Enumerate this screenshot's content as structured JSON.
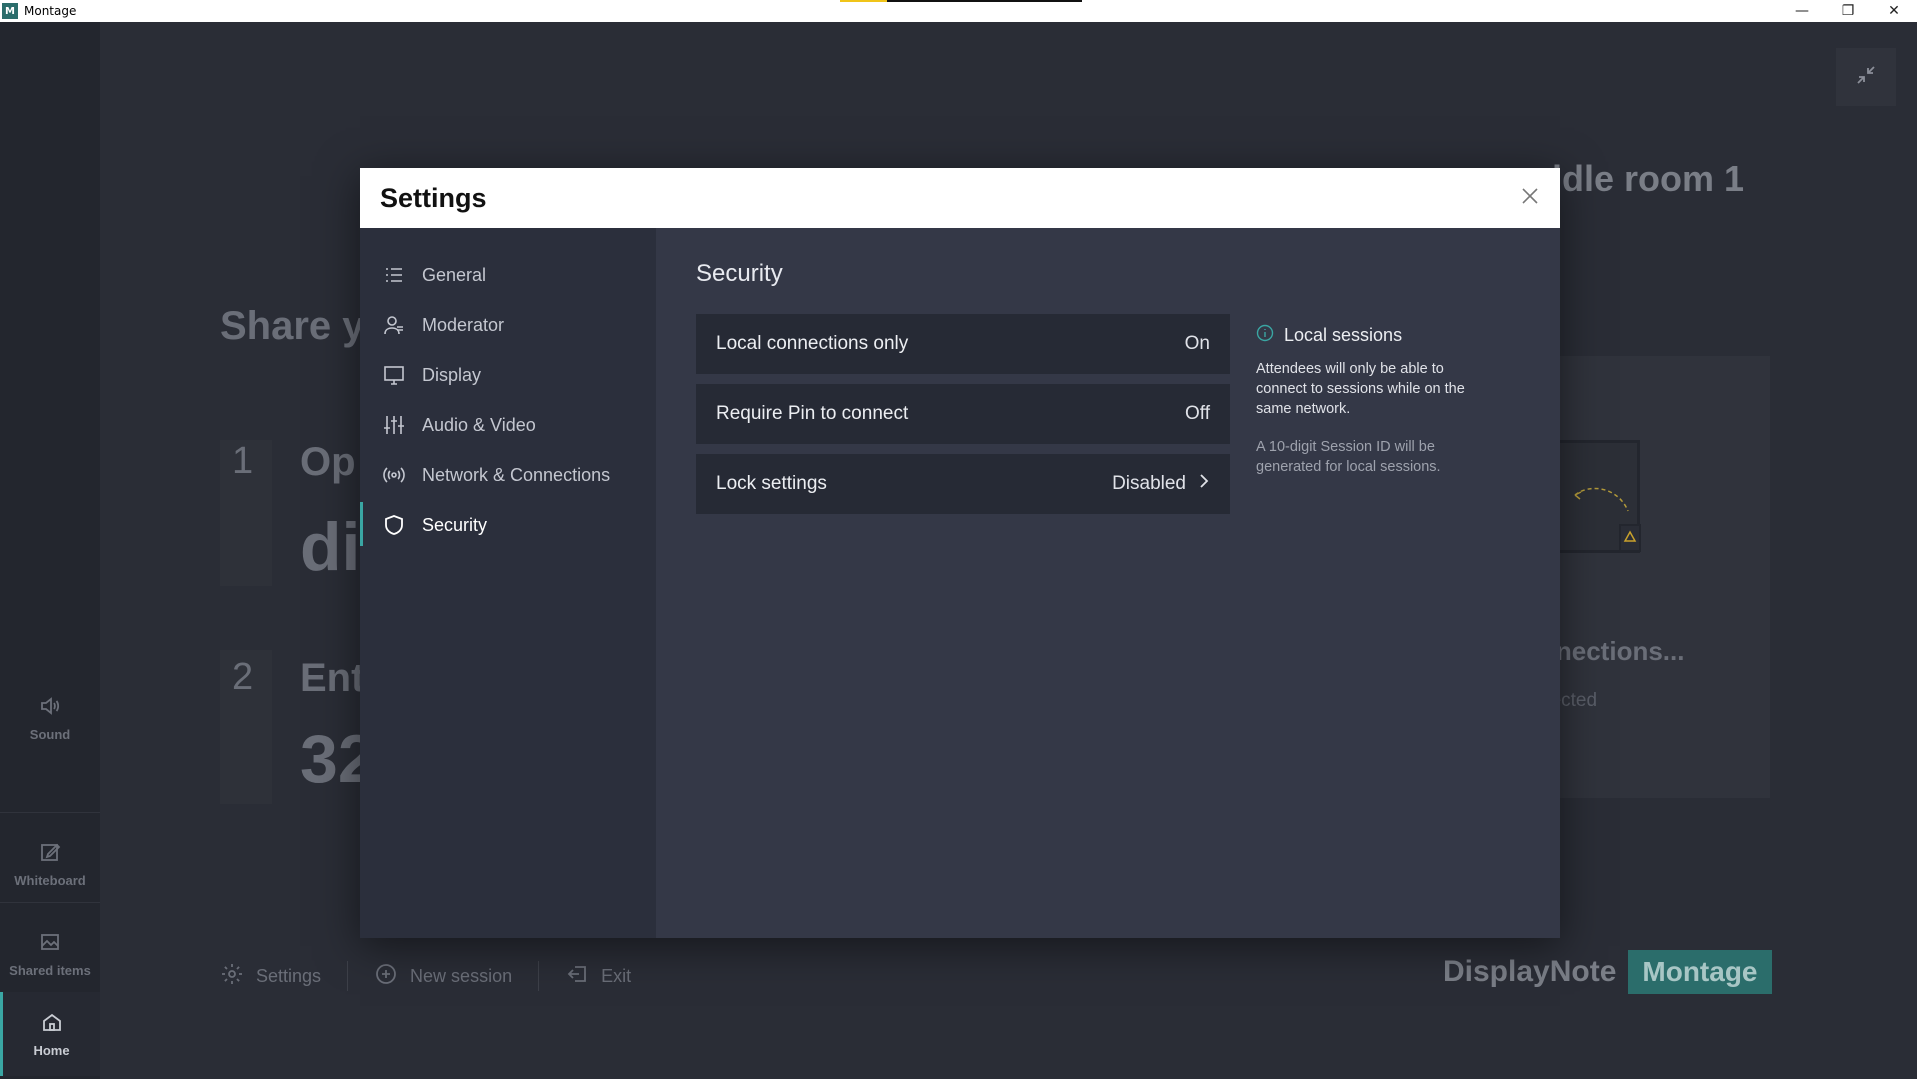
{
  "window": {
    "app_icon_letter": "M",
    "title": "Montage",
    "minimize": "—",
    "restore": "❐",
    "close": "✕"
  },
  "sidebar": {
    "items": [
      {
        "label": "Sound",
        "icon": "speaker-icon"
      },
      {
        "label": "Whiteboard",
        "icon": "edit-icon"
      },
      {
        "label": "Shared items",
        "icon": "image-icon"
      },
      {
        "label": "Home",
        "icon": "home-icon"
      }
    ]
  },
  "background": {
    "room_title": "ddle room 1",
    "share_title": "Share y",
    "step1": {
      "num": "1",
      "label": "Op",
      "big": "di"
    },
    "step2": {
      "num": "2",
      "label": "Ent",
      "big": "32"
    },
    "connections_title": "nnections...",
    "connections_sub": "nected",
    "bottom": {
      "settings": "Settings",
      "new_session": "New session",
      "exit": "Exit"
    },
    "brand": {
      "displaynote": "DisplayNote",
      "montage": "Montage"
    }
  },
  "modal": {
    "title": "Settings",
    "nav": [
      {
        "label": "General",
        "icon": "list-icon"
      },
      {
        "label": "Moderator",
        "icon": "user-icon"
      },
      {
        "label": "Display",
        "icon": "monitor-icon"
      },
      {
        "label": "Audio & Video",
        "icon": "sliders-icon"
      },
      {
        "label": "Network & Connections",
        "icon": "broadcast-icon"
      },
      {
        "label": "Security",
        "icon": "shield-icon",
        "active": true
      }
    ],
    "section_title": "Security",
    "rows": [
      {
        "label": "Local connections only",
        "value": "On"
      },
      {
        "label": "Require Pin to connect",
        "value": "Off"
      },
      {
        "label": "Lock settings",
        "value": "Disabled"
      }
    ],
    "info": {
      "title": "Local sessions",
      "p1": "Attendees will only be able to connect to sessions while on the same network.",
      "p2": "A 10-digit Session ID will be generated for local sessions."
    }
  },
  "colors": {
    "accent": "#3aa6a3",
    "brand_teal": "#2b6d6b",
    "modal_bg": "#343847",
    "nav_bg": "#2b2f3c",
    "row_bg": "#262a35"
  }
}
